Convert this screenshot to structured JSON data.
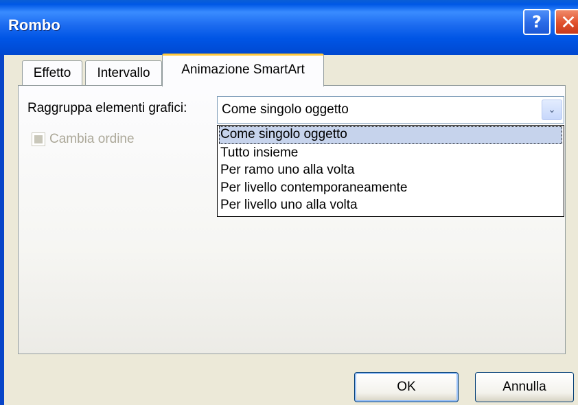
{
  "window": {
    "title": "Rombo",
    "help_glyph": "?",
    "close_glyph": "✕"
  },
  "tabs": [
    {
      "label": "Effetto"
    },
    {
      "label": "Intervallo"
    },
    {
      "label": "Animazione SmartArt",
      "active": true
    }
  ],
  "panel": {
    "group_label": "Raggruppa elementi grafici:",
    "combo_value": "Come singolo oggetto",
    "combo_arrow": "⌄",
    "options": [
      "Come singolo oggetto",
      "Tutto insieme",
      "Per ramo uno alla volta",
      "Per livello contemporaneamente",
      "Per livello uno alla volta"
    ],
    "checkbox_label": "Cambia ordine"
  },
  "buttons": {
    "ok": "OK",
    "cancel": "Annulla"
  },
  "colors": {
    "titlebar": "#0055e5",
    "face": "#ece9d8",
    "selection": "#c6d3ec"
  }
}
